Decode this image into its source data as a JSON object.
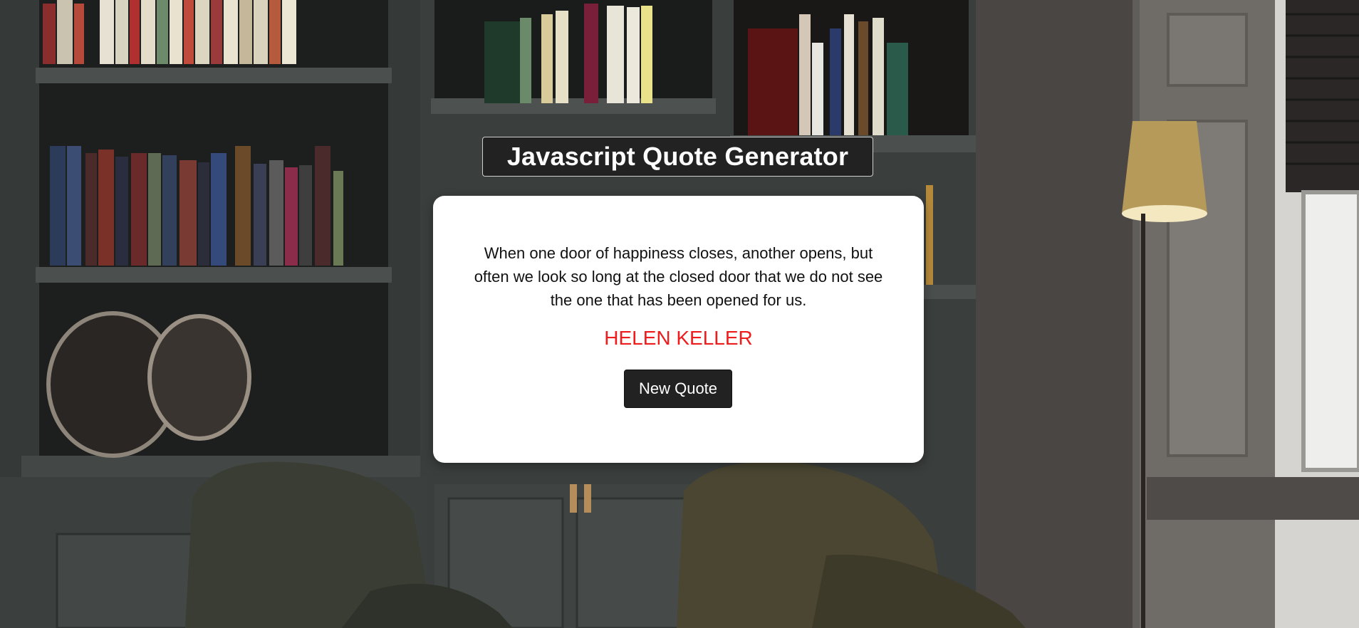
{
  "header": {
    "title": "Javascript Quote Generator"
  },
  "quote_card": {
    "quote": "When one door of happiness closes, another opens, but often we look so long at the closed door that we do not see the one that has been opened for us.",
    "author": "HELEN KELLER",
    "button_label": "New Quote"
  },
  "colors": {
    "author": "#ee1c1c",
    "button_bg": "#222222",
    "title_bg": "#222222",
    "card_bg": "#ffffff"
  }
}
